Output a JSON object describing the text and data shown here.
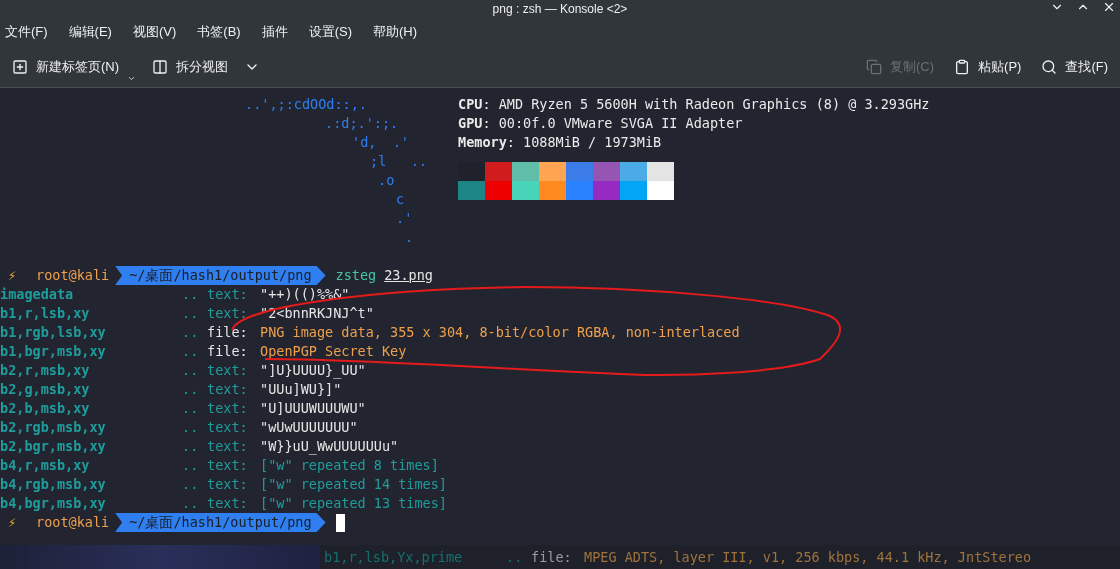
{
  "window": {
    "title": "png : zsh — Konsole <2>"
  },
  "menu": [
    {
      "label": "文件(F)"
    },
    {
      "label": "编辑(E)"
    },
    {
      "label": "视图(V)"
    },
    {
      "label": "书签(B)"
    },
    {
      "label": "插件"
    },
    {
      "label": "设置(S)"
    },
    {
      "label": "帮助(H)"
    }
  ],
  "toolbar": {
    "left": [
      {
        "kind": "new-tab",
        "label": "新建标签页(N)"
      },
      {
        "kind": "split",
        "label": "拆分视图"
      }
    ],
    "right": [
      {
        "kind": "copy",
        "label": "复制(C)",
        "disabled": true
      },
      {
        "kind": "paste",
        "label": "粘贴(P)",
        "disabled": false
      },
      {
        "kind": "find",
        "label": "查找(F)",
        "disabled": false
      }
    ]
  },
  "terminal": {
    "logo": [
      "..',;:cdOOd::,.",
      ".:d;.':;.",
      "'d,  .'",
      ";l   ..",
      ".o",
      "c",
      ".'",
      "."
    ],
    "info": [
      "**CPU**: AMD Ryzen 5 5600H with Radeon Graphics (8) @ 3.293GHz",
      "**GPU**: 00:0f.0 VMware SVGA II Adapter",
      "**Memory**: 1088MiB / 1973MiB"
    ],
    "palette": [
      [
        {
          "color": "#1f222a"
        },
        {
          "color": "#d01c1c"
        },
        {
          "color": "#5fbdaa"
        },
        {
          "color": "#ffa552"
        },
        {
          "color": "#3b7ce8"
        },
        {
          "color": "#9755b3"
        },
        {
          "color": "#4aabe6"
        },
        {
          "color": "#e4e4e4"
        }
      ],
      [
        {
          "color": "#1d8585"
        },
        {
          "color": "#ec0000"
        },
        {
          "color": "#47d4b9"
        },
        {
          "color": "#ff8a1f"
        },
        {
          "color": "#2981ff"
        },
        {
          "color": "#962ac3"
        },
        {
          "color": "#03a6f5"
        },
        {
          "color": "#ffffff"
        }
      ]
    ],
    "prompt": {
      "bolt": "⚡",
      "user": "root@kali",
      "path": "~/桌面/hash1/output/png",
      "command": "zsteg",
      "argument": "23.png"
    },
    "rows": [
      {
        "name": "imagedata",
        "dots": "..",
        "key": "text:",
        "value": "\"++)(()%%&\"",
        "kind": "text"
      },
      {
        "name": "b1,r,lsb,xy",
        "dots": "..",
        "key": "text:",
        "value": "\"2<bnnRKJNJ^t\"",
        "kind": "text"
      },
      {
        "name": "b1,rgb,lsb,xy",
        "dots": "..",
        "key": "file:",
        "value": "PNG image data, 355 x 304, 8-bit/color RGBA, non-interlaced",
        "kind": "file"
      },
      {
        "name": "b1,bgr,msb,xy",
        "dots": "..",
        "key": "file:",
        "value": "OpenPGP Secret Key",
        "kind": "file"
      },
      {
        "name": "b2,r,msb,xy",
        "dots": "..",
        "key": "text:",
        "value": "\"]U}UUUU}_UU\"",
        "kind": "text"
      },
      {
        "name": "b2,g,msb,xy",
        "dots": "..",
        "key": "text:",
        "value": "\"UUu]WU}]\"",
        "kind": "text"
      },
      {
        "name": "b2,b,msb,xy",
        "dots": "..",
        "key": "text:",
        "value": "\"U]UUUWUUUWU\"",
        "kind": "text"
      },
      {
        "name": "b2,rgb,msb,xy",
        "dots": "..",
        "key": "text:",
        "value": "\"wUwUUUUUUU\"",
        "kind": "text"
      },
      {
        "name": "b2,bgr,msb,xy",
        "dots": "..",
        "key": "text:",
        "value": "\"W}}uU_WwUUUUUUu\"",
        "kind": "text"
      },
      {
        "name": "b4,r,msb,xy",
        "dots": "..",
        "key": "text:",
        "value": "[\"w\" repeated 8 times]",
        "kind": "repeat"
      },
      {
        "name": "b4,rgb,msb,xy",
        "dots": "..",
        "key": "text:",
        "value": "[\"w\" repeated 14 times]",
        "kind": "repeat"
      },
      {
        "name": "b4,bgr,msb,xy",
        "dots": "..",
        "key": "text:",
        "value": "[\"w\" repeated 13 times]",
        "kind": "repeat"
      }
    ],
    "final_prompt": {
      "bolt": "⚡",
      "user": "root@kali",
      "path": "~/桌面/hash1/output/png"
    }
  },
  "background_terminal": {
    "name": "b1,r,lsb,Yx,prime",
    "dots": "..",
    "key": "file:",
    "value": "MPEG ADTS, layer III, v1, 256 kbps, 44.1 kHz, JntStereo"
  }
}
